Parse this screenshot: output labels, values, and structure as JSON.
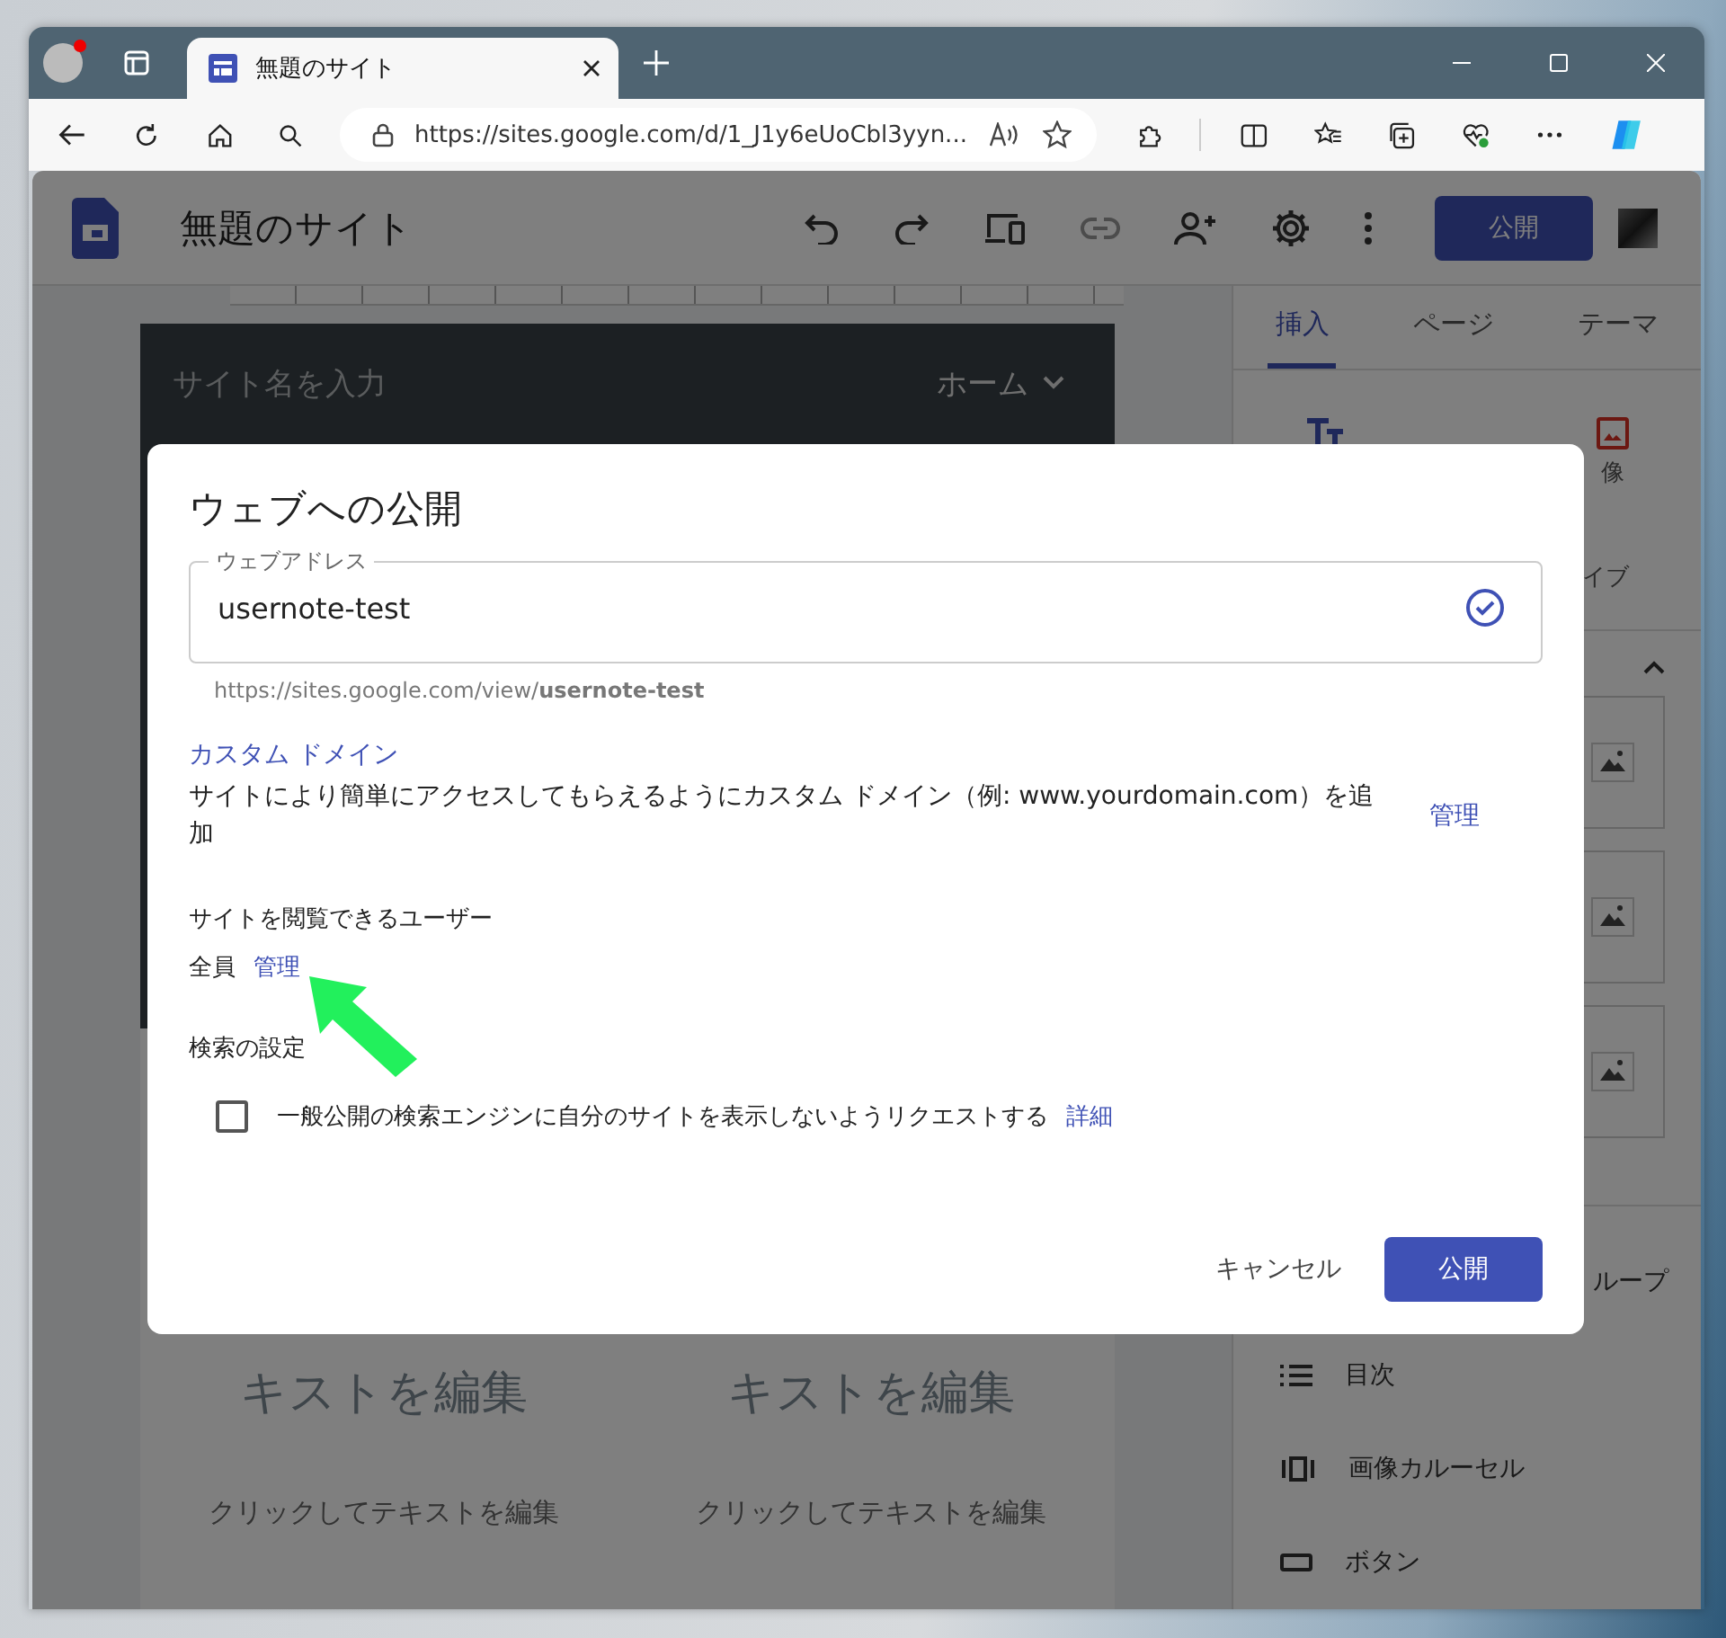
{
  "browser": {
    "tab_title": "無題のサイト",
    "address": "https://sites.google.com/d/1_J1y6eUoCbl3yyn..."
  },
  "app": {
    "title": "無題のサイト",
    "publish_button": "公開"
  },
  "page": {
    "site_name_placeholder": "サイト名を入力",
    "nav_item": "ホーム",
    "headings": [
      "キストを編集",
      "キストを編集"
    ],
    "texts": [
      "クリックしてテキストを編集",
      "クリックしてテキストを編集"
    ]
  },
  "panel": {
    "tabs": [
      {
        "label": "挿入",
        "selected": true
      },
      {
        "label": "ページ",
        "selected": false
      },
      {
        "label": "テーマ",
        "selected": false
      }
    ],
    "insert_labels": [
      "像",
      "イブ"
    ],
    "components": [
      {
        "kind": "group",
        "label": "ループ"
      },
      {
        "kind": "toc",
        "label": "目次"
      },
      {
        "kind": "carousel",
        "label": "画像カルーセル"
      },
      {
        "kind": "button",
        "label": "ボタン"
      }
    ]
  },
  "dialog": {
    "title": "ウェブへの公開",
    "address_field": {
      "label": "ウェブアドレス",
      "value": "usernote-test",
      "valid": true
    },
    "url_hint": "https://sites.google.com/view/**usernote-test**",
    "custom_domain": {
      "link": "カスタム ドメイン",
      "description": "サイトにより簡単にアクセスしてもらえるようにカスタム ドメイン（例: www.yourdomain.com）を追加",
      "manage": "管理"
    },
    "viewers": {
      "label": "サイトを閲覧できるユーザー",
      "value": "全員",
      "manage": "管理"
    },
    "search": {
      "label": "検索の設定",
      "checkbox": {
        "label": "一般公開の検索エンジンに自分のサイトを表示しないようリクエストする",
        "checked": false,
        "link": "詳細"
      }
    },
    "buttons": {
      "cancel": "キャンセル",
      "publish": "公開"
    }
  }
}
